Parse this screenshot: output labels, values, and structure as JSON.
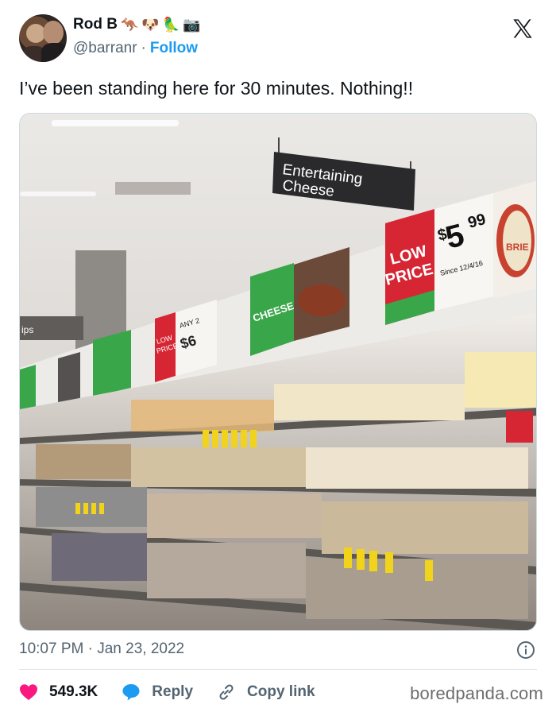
{
  "header": {
    "display_name": "Rod B",
    "name_emojis": [
      "🦘",
      "🐶",
      "🦜",
      "📷"
    ],
    "handle": "@barranr",
    "separator": "·",
    "follow_label": "Follow"
  },
  "tweet": {
    "text": "I’ve been standing here for 30 minutes. Nothing!!"
  },
  "photo": {
    "hanging_sign": {
      "line1": "Entertaining",
      "line2": "Cheese"
    },
    "price_tag": {
      "label_line1": "LOW",
      "label_line2": "PRICE",
      "price_dollar": "$",
      "price_whole": "5",
      "price_cents": "99",
      "since": "Since 12/4/16"
    },
    "brie_label": "BRIE",
    "cheese_banner": "CHEESE",
    "small_tag": {
      "line1": "LOW",
      "line2": "PRICE",
      "any": "ANY 2",
      "price": "$6"
    },
    "partial_text": "ips"
  },
  "meta": {
    "timestamp": "10:07 PM · Jan 23, 2022"
  },
  "actions": {
    "like_count": "549.3K",
    "reply_label": "Reply",
    "copy_link_label": "Copy link"
  },
  "watermark": "boredpanda.com",
  "colors": {
    "like_red": "#f91880",
    "reply_blue": "#1d9bf0",
    "follow_blue": "#1d9bf0",
    "price_red": "#d62634",
    "banner_green": "#3aa64a"
  }
}
